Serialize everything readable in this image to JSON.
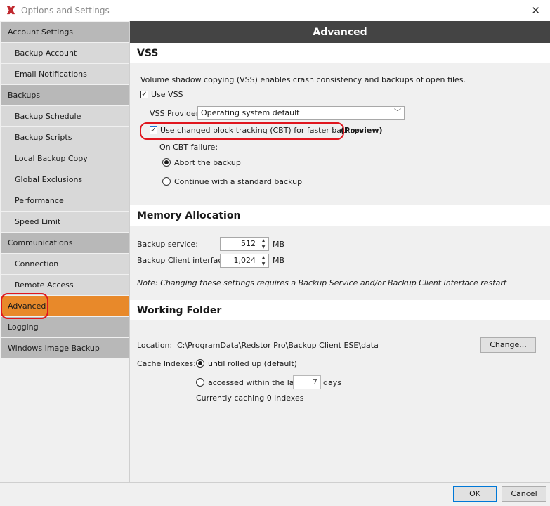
{
  "window": {
    "title": "Options and Settings",
    "close_glyph": "✕"
  },
  "sidebar": {
    "items": [
      {
        "label": "Account Settings"
      },
      {
        "label": "Backup Account"
      },
      {
        "label": "Email Notifications"
      },
      {
        "label": "Backups"
      },
      {
        "label": "Backup Schedule"
      },
      {
        "label": "Backup Scripts"
      },
      {
        "label": "Local Backup Copy"
      },
      {
        "label": "Global Exclusions"
      },
      {
        "label": "Performance"
      },
      {
        "label": "Speed Limit"
      },
      {
        "label": "Communications"
      },
      {
        "label": "Connection"
      },
      {
        "label": "Remote Access"
      },
      {
        "label": "Advanced"
      },
      {
        "label": "Logging"
      },
      {
        "label": "Windows Image Backup"
      }
    ]
  },
  "header": {
    "title": "Advanced"
  },
  "vss": {
    "heading": "VSS",
    "description": "Volume shadow copying (VSS) enables crash consistency and backups of open files.",
    "use_vss_label": "Use VSS",
    "provider_label": "VSS Provider:",
    "provider_value": "Operating system default",
    "cbt_label": "Use changed block tracking (CBT) for faster backups",
    "cbt_preview": "(Preview)",
    "cbt_failure_label": "On CBT failure:",
    "abort_label": "Abort the backup",
    "continue_label": "Continue with a standard backup",
    "check_glyph": "✓"
  },
  "memory": {
    "heading": "Memory Allocation",
    "service_label": "Backup service:",
    "service_value": "512",
    "service_unit": "MB",
    "client_label": "Backup Client interface:",
    "client_value": "1,024",
    "client_unit": "MB",
    "note": "Note: Changing these settings requires a Backup Service and/or Backup Client Interface restart",
    "spin_up": "▲",
    "spin_down": "▼"
  },
  "working_folder": {
    "heading": "Working Folder",
    "location_label": "Location:",
    "location_value": "C:\\ProgramData\\Redstor Pro\\Backup Client ESE\\data",
    "change_label": "Change...",
    "cache_label": "Cache Indexes:",
    "until_label": "until rolled up (default)",
    "accessed_label": "accessed within the last",
    "days_value": "7",
    "days_label": "days",
    "caching_status": "Currently caching 0 indexes"
  },
  "footer": {
    "ok_label": "OK",
    "cancel_label": "Cancel"
  },
  "colors": {
    "active_nav": "#e8892a",
    "header_bg": "#444444",
    "highlight": "#e0161e"
  }
}
